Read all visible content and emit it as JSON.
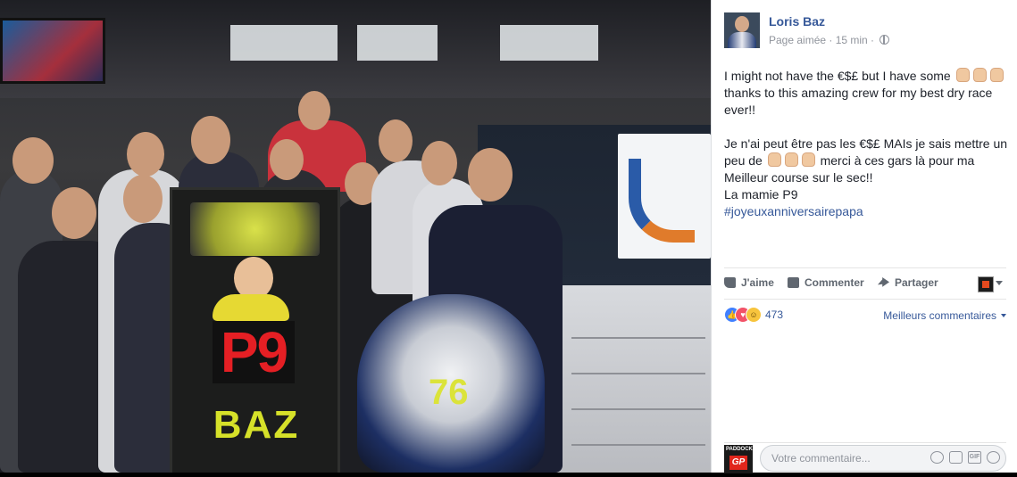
{
  "post": {
    "author": "Loris Baz",
    "meta": "Page aimée · 15 min ·",
    "text": {
      "line1_a": "I might not have the €$£ but I have some",
      "line1_b": "thanks to this amazing crew for my best dry race ever!!",
      "line2_a": "Je n'ai peut être pas les €$£ MAIs je sais mettre un peu de",
      "line2_b": "merci à ces gars là pour ma Meilleur course sur le sec!!",
      "line3": "La mamie P9",
      "hashtag": "#joyeuxanniversairepapa"
    }
  },
  "actions": {
    "like": "J'aime",
    "comment": "Commenter",
    "share": "Partager"
  },
  "reactions": {
    "count": "473",
    "sort_label": "Meilleurs commentaires"
  },
  "composer": {
    "placeholder": "Votre commentaire...",
    "avatar_top": "PADDOCK",
    "avatar_logo": "GP"
  },
  "photo": {
    "sign_p9": "P9",
    "sign_baz": "BAZ",
    "board_number": "76",
    "bike_number": "76"
  },
  "colors": {
    "link": "#365899",
    "text": "#1d2129",
    "meta": "#90949c",
    "action": "#606770"
  }
}
